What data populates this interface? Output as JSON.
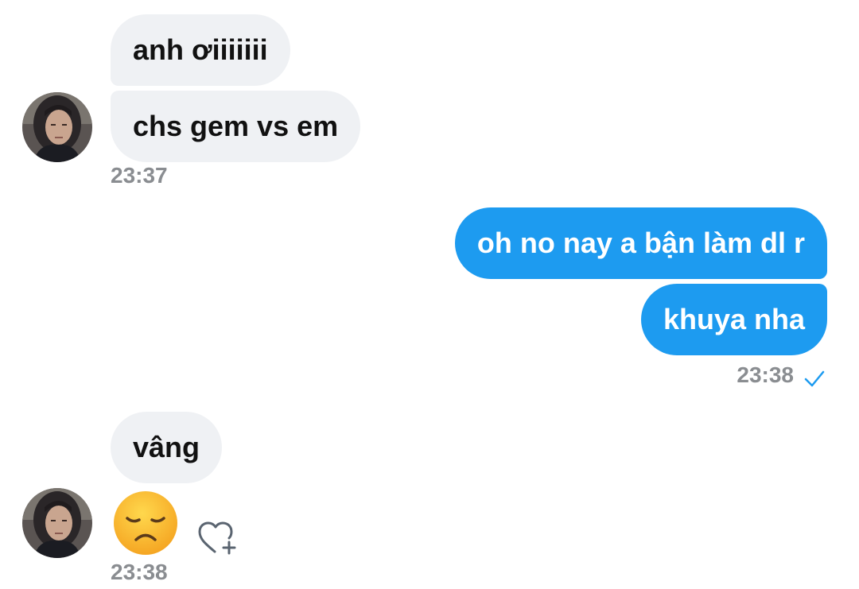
{
  "conversation": {
    "group1": {
      "messages": [
        "anh ơiiiiiii",
        "chs gem vs em"
      ],
      "time": "23:37"
    },
    "group2": {
      "messages": [
        "oh no nay a bận làm dl r",
        "khuya nha"
      ],
      "time": "23:38",
      "status_icon": "checkmark-icon"
    },
    "group3": {
      "messages": [
        "vâng"
      ],
      "emoji": "disappointed-face",
      "reaction_icon": "heart-add-icon",
      "time": "23:38"
    }
  },
  "colors": {
    "incoming_bubble": "#eff1f4",
    "outgoing_bubble": "#1d9bf0",
    "timestamp": "#8a8d91",
    "accent": "#1d9bf0"
  }
}
